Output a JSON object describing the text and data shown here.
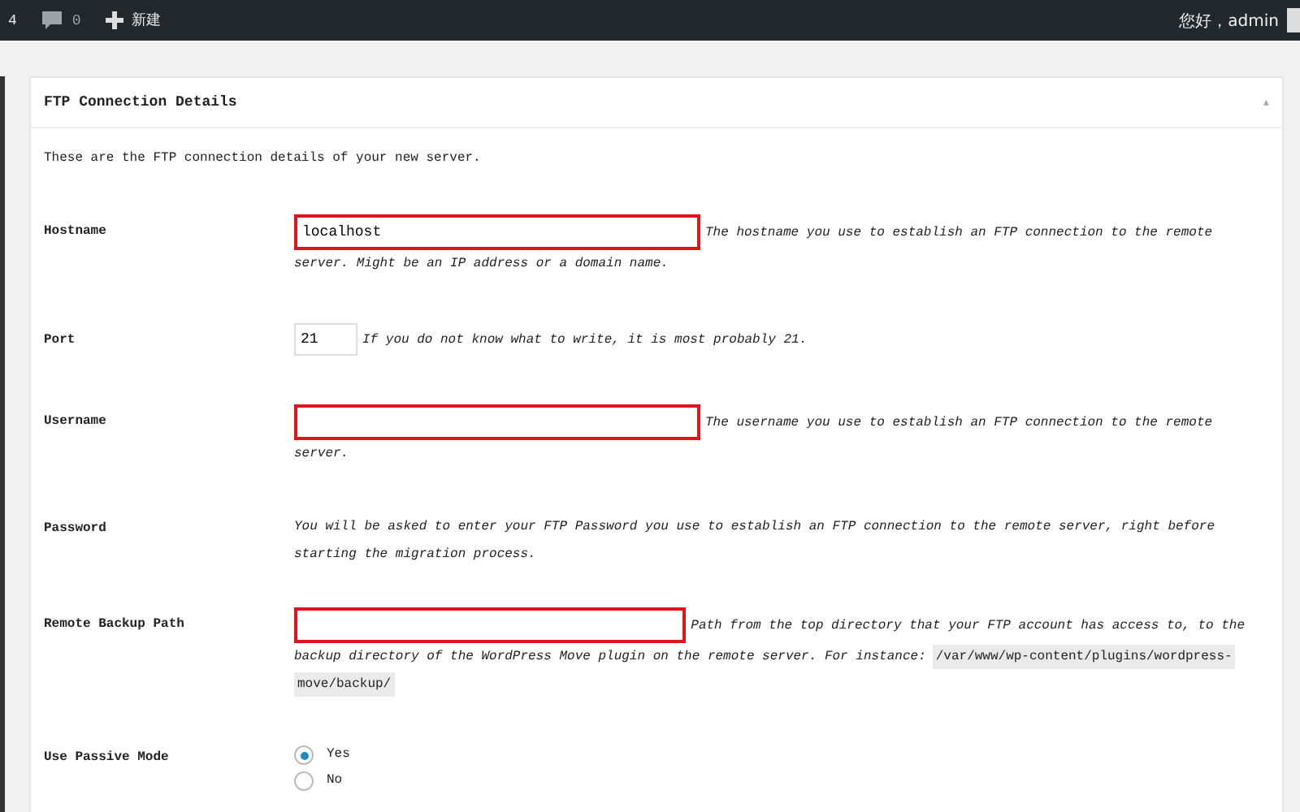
{
  "admin_bar": {
    "left_count": "4",
    "comments_count": "0",
    "new_label": "新建",
    "greeting": "您好，admin"
  },
  "panel": {
    "title": "FTP Connection Details",
    "toggle": "▲",
    "intro": "These are the FTP connection details of your new server.",
    "fields": [
      {
        "kind": "text",
        "label": "Hostname",
        "value": "localhost",
        "highlighted": true,
        "description": [
          "The hostname you use to establish an FTP connection to the remote",
          "server. Might be an IP address or a domain name."
        ]
      },
      {
        "kind": "small",
        "label": "Port",
        "value": "21",
        "highlighted": false,
        "description": [
          "If you do not know what to write, it is most probably 21."
        ]
      },
      {
        "kind": "text",
        "label": "Username",
        "highlighted": true,
        "description": [
          "The username you use to establish an FTP connection to the remote",
          "server."
        ]
      },
      {
        "kind": "note",
        "label": "Password",
        "description": [
          "You will be asked to enter your FTP Password you use to establish an FTP connection to the remote server, right before",
          "starting the migration process."
        ]
      },
      {
        "kind": "text",
        "label": "Remote Backup Path",
        "highlighted": true,
        "description": [
          "Path from the top directory that your FTP account has access to, to the",
          "backup directory of the WordPress Move plugin on the remote server. For instance:"
        ],
        "code": [
          "/var/www/wp-content/plugins/wordpress-",
          "move/backup/"
        ]
      },
      {
        "kind": "radio",
        "label": "Use Passive Mode",
        "options": [
          {
            "label": "Yes",
            "selected": true
          },
          {
            "label": "No",
            "selected": false
          }
        ]
      }
    ]
  }
}
